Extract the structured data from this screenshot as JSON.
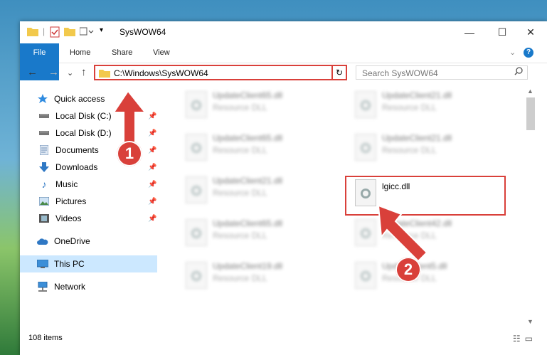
{
  "window": {
    "title": "SysWOW64",
    "minimize": "—",
    "maximize": "☐",
    "close": "✕"
  },
  "ribbon": {
    "tabs": [
      {
        "label": "File"
      },
      {
        "label": "Home"
      },
      {
        "label": "Share"
      },
      {
        "label": "View"
      }
    ],
    "expand": "⌄",
    "help": "?"
  },
  "navbar": {
    "back": "←",
    "forward": "→",
    "recent": "⌄",
    "up": "↑",
    "path": "C:\\Windows\\SysWOW64",
    "dropdown": "⌄",
    "refresh": "↻",
    "search_placeholder": "Search SysWOW64"
  },
  "sidebar": {
    "items": [
      {
        "label": "Quick access",
        "icon": "star-icon",
        "pinned": false
      },
      {
        "label": "Local Disk (C:)",
        "icon": "drive-icon",
        "pinned": true
      },
      {
        "label": "Local Disk (D:)",
        "icon": "drive-icon",
        "pinned": true
      },
      {
        "label": "Documents",
        "icon": "documents-icon",
        "pinned": true
      },
      {
        "label": "Downloads",
        "icon": "download-icon",
        "pinned": true
      },
      {
        "label": "Music",
        "icon": "music-icon",
        "pinned": true
      },
      {
        "label": "Pictures",
        "icon": "pictures-icon",
        "pinned": true
      },
      {
        "label": "Videos",
        "icon": "videos-icon",
        "pinned": true
      },
      {
        "label": "OneDrive",
        "icon": "cloud-icon",
        "pinned": false
      },
      {
        "label": "This PC",
        "icon": "computer-icon",
        "pinned": false,
        "selected": true
      },
      {
        "label": "Network",
        "icon": "network-icon",
        "pinned": false
      }
    ]
  },
  "files": [
    {
      "name": "UpdateClient65.dll",
      "type": "Resource DLL",
      "blurred": true
    },
    {
      "name": "UpdateClient21.dll",
      "type": "Resource DLL",
      "blurred": true
    },
    {
      "name": "UpdateClient65.dll",
      "type": "Resource DLL",
      "blurred": true
    },
    {
      "name": "UpdateClient21.dll",
      "type": "Resource DLL",
      "blurred": true
    },
    {
      "name": "UpdateClient21.dll",
      "type": "Resource DLL",
      "blurred": true
    },
    {
      "name": "lgicc.dll",
      "type": "",
      "blurred": false
    },
    {
      "name": "UpdateClient65.dll",
      "type": "Resource DLL",
      "blurred": true
    },
    {
      "name": "UpdateClient42.dll",
      "type": "Resource DLL",
      "blurred": true
    },
    {
      "name": "UpdateClient19.dll",
      "type": "Resource DLL",
      "blurred": true
    },
    {
      "name": "UpdateClient5.dll",
      "type": "Resource DLL",
      "blurred": true
    }
  ],
  "status": {
    "count": "108 items"
  },
  "annotations": {
    "step1": "1",
    "step2": "2",
    "color": "#d9403a"
  }
}
